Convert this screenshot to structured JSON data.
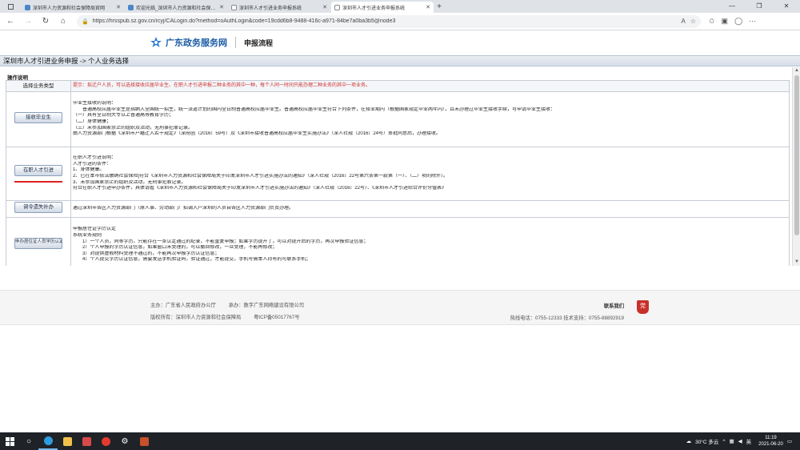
{
  "browser": {
    "tabs": [
      {
        "title": "深圳市人力资源和社会保障局官网",
        "active": false
      },
      {
        "title": "欢迎光临_深圳市人力资源和社会保障局",
        "active": false
      },
      {
        "title": "深圳市人才引进业务申报系统",
        "active": false
      },
      {
        "title": "深圳市人才引进业务申报系统",
        "active": true
      }
    ],
    "new_tab_label": "+",
    "url": "https://hrsspub.sz.gov.cn/rcyj/CALogin.do?method=oAuthLogin&code=19cdd6b8-9488-416c-a971-84be7a0ba3b5@node3"
  },
  "site_header": {
    "brand": "广东政务服务网",
    "subtitle": "申报流程"
  },
  "page": {
    "title": "深圳市人才引进业务申报 -> 个人业务选择",
    "section_label": "操作说明"
  },
  "table": {
    "header": {
      "type_label": "选择业务类型",
      "hint": "提示：拟迁户人员，可以选择接收应届毕业生、在职人才引进申报二种业务的其中一种，每个人同一时间只能办理二种业务的其中一项业务。"
    },
    "rows": [
      {
        "button": "接收毕业生",
        "lines": [
          "毕业生接收的说明：",
          "普通高校应届毕业生是指纳入全国统一招生，统一派遣计划的国内全日制普通高校应届毕业生。普通高校应届毕业生符合下列条件，在择业期内（根据国家规定毕业两年内），且未办理过毕业生接收手续，可申请毕业生接收：",
          "（一）具有全日制大专以上普通高等教育学历；",
          "（二）身体健康；",
          "（三）未参加国家禁止的组织及活动，无刑事犯罪记录。",
          "由人力资源部门根据《深圳市户籍迁入若干规定》（深府函〔2016〕59号）及《深圳市接收普通高校应届毕业生实施办法》（深人社规〔2016〕24号）审批同意后，办理接收。"
        ]
      },
      {
        "button": "在职人才引进",
        "lines": [
          "在职人才引进说明：",
          "人才引进的条件：",
          "1、身体健康。",
          "2、已在本市依法缴纳社会保险[符合《深圳市人力资源和社会保障局关于印发深圳市人才引进实施办法的通知》（深人社规〔2016〕22号第六条第一款第（一）、（二）项的除外〕。",
          "3、未参加国家禁止的组织及活动，无刑事犯罪记录。",
          "符合在职人才引进申办条件，具体请看《深圳市人力资源和社会保障局关于印发深圳市人才引进实施办法的通知》（深人社规〔2016〕22号）、《深圳市人才引进综合评价分值表》"
        ]
      },
      {
        "button": "调令遗失补办",
        "lines": [
          "通过深圳市各区人力资源部门（原人事、劳动部门）招调入户深圳的人员自各区人力资源部门负责办理。"
        ]
      },
      {
        "button": "申办居住证人员学历认定",
        "lines": [
          "申报居住证学历认定",
          "系统业务规则",
          "1）一个人员，同等学历，只能存在一条认定通过的纪录，不能重复申报；如果学历提升了，可以对提升后的学历，再次申报验证信息；",
          "2）个人申报的学历认证信息，如果窗口未受理的，可以撤回修改，一旦受理，不能再修改；",
          "3）对提供虚假材料受理不通过的，不能再次申报学历认证信息；",
          "4）个人提交学历认证信息，需要发送手机验证码，验证通过，才能提交，手机号需本人持有的可联系手机；"
        ]
      }
    ]
  },
  "footer": {
    "host": "主办：广东省人民政府办公厅",
    "undertaker": "承办：数字广东网络建设有限公司",
    "copyright": "版权所有：深圳市人力资源和社会保障局",
    "icp": "粤ICP备05017767号",
    "contact_title": "联系我们",
    "hotline": "热线电话：0755-12333 技术支持：0755-88892919",
    "badge": "党"
  },
  "taskbar": {
    "weather": "30°C 多云",
    "ime": "英",
    "time": "11:19",
    "date": "2021-06-20"
  }
}
